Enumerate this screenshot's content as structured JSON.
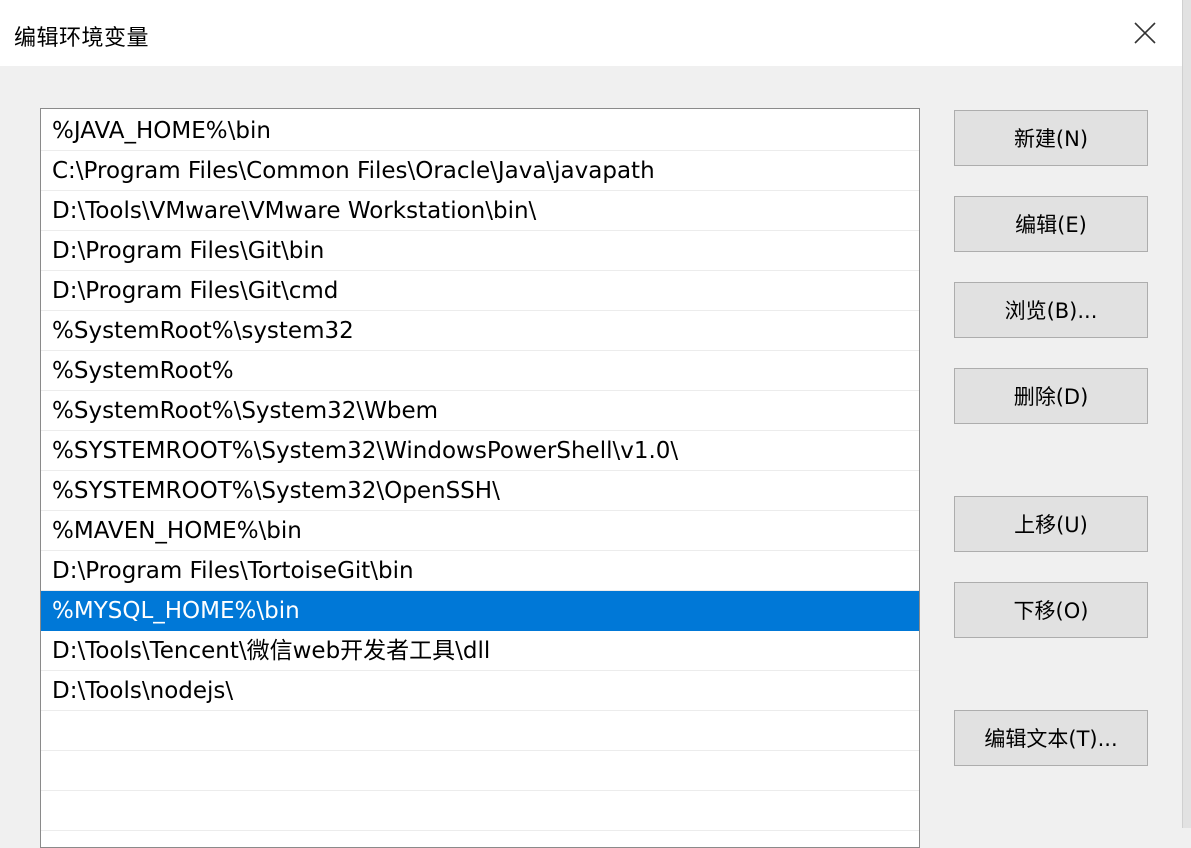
{
  "dialog": {
    "title": "编辑环境变量",
    "close_icon": "close-icon"
  },
  "path_list": {
    "selected_index": 12,
    "items": [
      "%JAVA_HOME%\\bin",
      "C:\\Program Files\\Common Files\\Oracle\\Java\\javapath",
      "D:\\Tools\\VMware\\VMware Workstation\\bin\\",
      "D:\\Program Files\\Git\\bin",
      "D:\\Program Files\\Git\\cmd",
      "%SystemRoot%\\system32",
      "%SystemRoot%",
      "%SystemRoot%\\System32\\Wbem",
      "%SYSTEMROOT%\\System32\\WindowsPowerShell\\v1.0\\",
      "%SYSTEMROOT%\\System32\\OpenSSH\\",
      "%MAVEN_HOME%\\bin",
      "D:\\Program Files\\TortoiseGit\\bin",
      "%MYSQL_HOME%\\bin",
      "D:\\Tools\\Tencent\\微信web开发者工具\\dll",
      "D:\\Tools\\nodejs\\",
      "",
      "",
      ""
    ]
  },
  "buttons": {
    "new": "新建(N)",
    "edit": "编辑(E)",
    "browse": "浏览(B)...",
    "delete": "删除(D)",
    "move_up": "上移(U)",
    "move_down": "下移(O)",
    "edit_text": "编辑文本(T)..."
  },
  "colors": {
    "selection": "#0078d7",
    "window_bg": "#f0f0f0",
    "button_bg": "#e1e1e1"
  }
}
